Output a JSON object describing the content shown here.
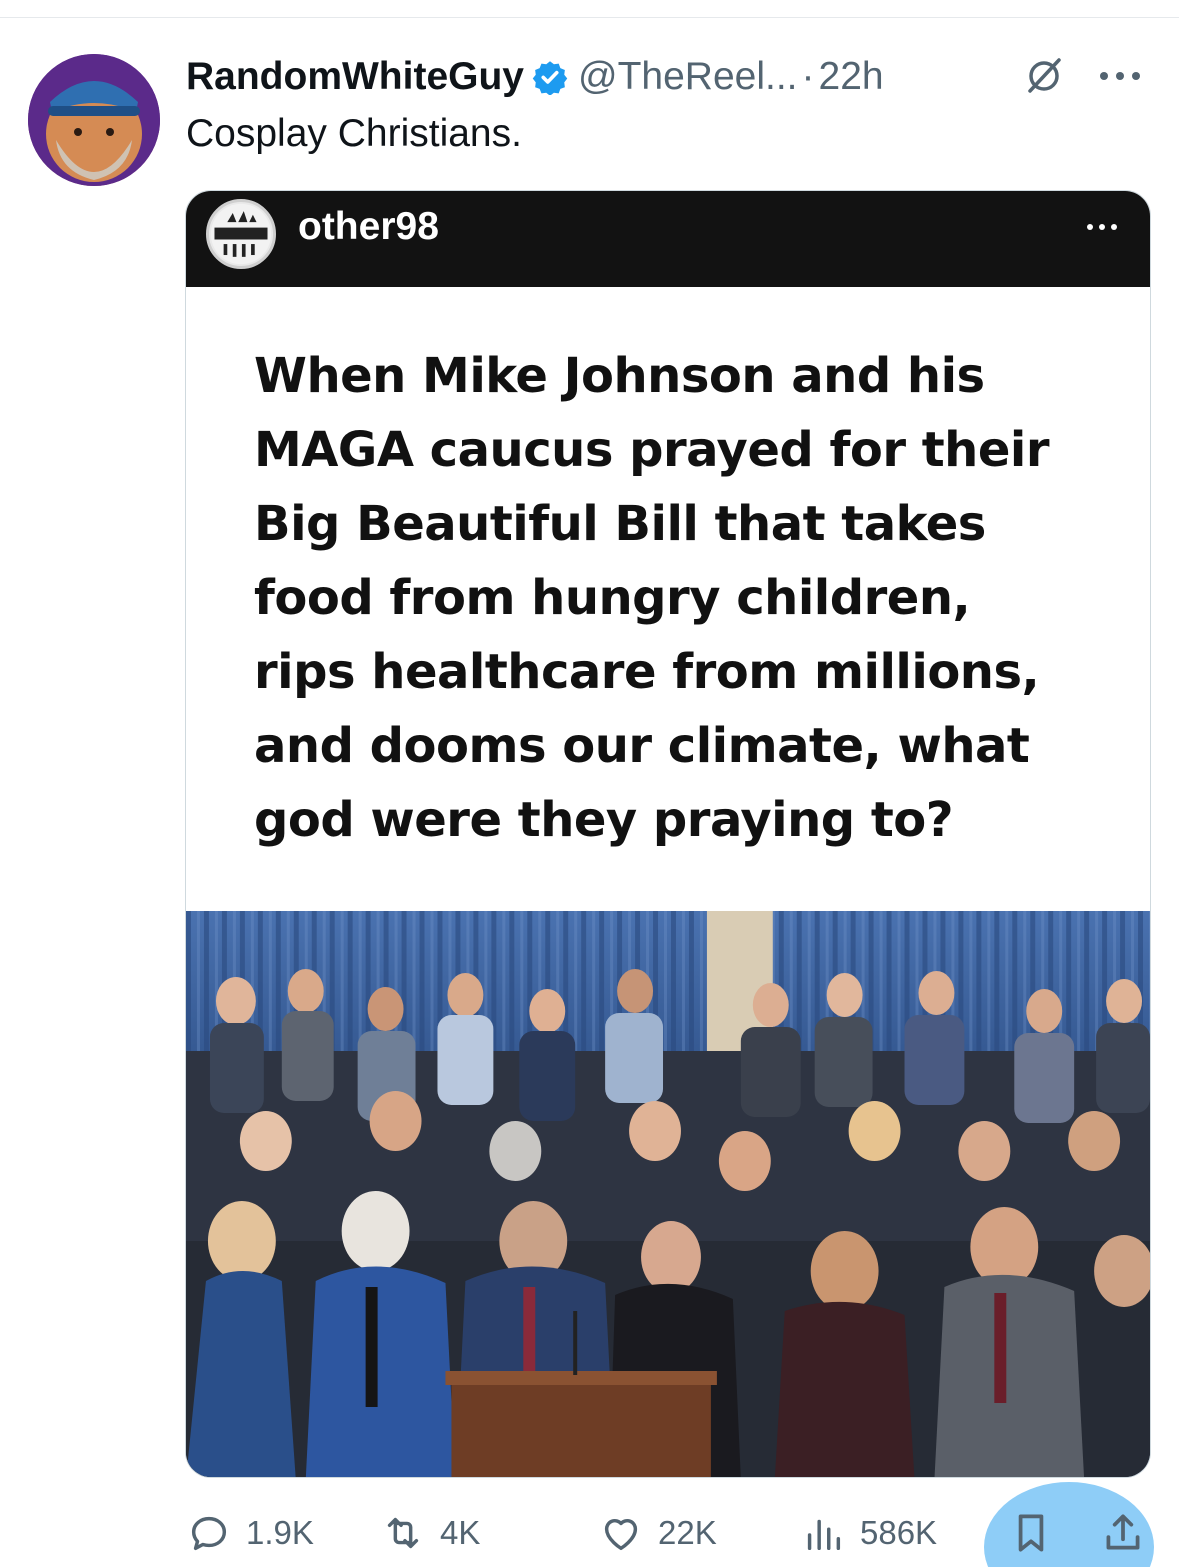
{
  "post": {
    "display_name": "RandomWhiteGuy",
    "handle": "@TheReel...",
    "separator": "·",
    "time": "22h",
    "text": "Cosplay Christians.",
    "icons": {
      "avatar": "avatar",
      "verified": "verified-badge-icon",
      "grok": "grok-icon",
      "more": "more-icon"
    }
  },
  "embedded_media": {
    "ig_username": "other98",
    "meme_lines": [
      "When Mike Johnson and his",
      "MAGA caucus prayed for their",
      "Big Beautiful Bill that takes",
      "food from hungry children,",
      "rips healthcare from millions,",
      "and dooms our climate, what",
      "god were they praying to?"
    ]
  },
  "actions": {
    "replies": "1.9K",
    "reposts": "4K",
    "likes": "22K",
    "views": "586K"
  },
  "colors": {
    "verified_blue": "#1d9bf0",
    "secondary_text": "#536471",
    "ig_bar": "#121212",
    "curtain_blue": "#3f66a5"
  }
}
